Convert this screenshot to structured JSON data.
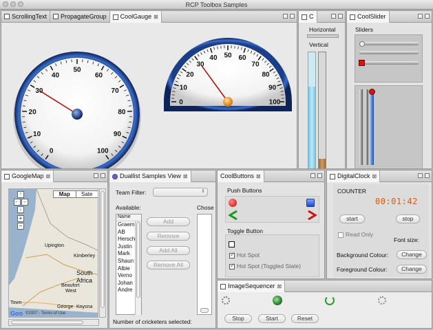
{
  "window": {
    "title": "RCP Toolbox Samples"
  },
  "gauge_pane": {
    "tabs": [
      "ScrollingText",
      "PropagateGroup",
      "CoolGauge"
    ],
    "full_gauge": {
      "ticks": [
        "0",
        "10",
        "20",
        "30",
        "40",
        "50",
        "60",
        "70",
        "80",
        "90",
        "100"
      ],
      "value": 30
    },
    "half_gauge": {
      "ticks": [
        "0",
        "10",
        "20",
        "30",
        "40",
        "50",
        "60",
        "70",
        "80",
        "90",
        "100"
      ],
      "value": 30
    }
  },
  "c_pane": {
    "tab": "C",
    "horizontal_label": "Horizontal",
    "vertical_label": "Vertical",
    "vertical_level": 0.1
  },
  "slider_pane": {
    "tab": "CoolSlider",
    "sliders_label": "Sliders"
  },
  "map_pane": {
    "tab": "GoogleMap",
    "map_type_options": [
      "Map",
      "Sate"
    ],
    "places": [
      "Upington",
      "Kimberley",
      "South",
      "Africa",
      "Beaufort",
      "West",
      "George",
      "Knysna",
      "Town"
    ],
    "copyright": "©2007 - Terms of Use"
  },
  "duallist_pane": {
    "tab": "Duallist Samples View",
    "team_filter_label": "Team Filter:",
    "available_label": "Available:",
    "chosen_label": "Chose",
    "column_header": "Name",
    "available_items": [
      "Graem",
      "AB",
      "Hersch",
      "Justin",
      "Mark",
      "Shaun",
      "Albie",
      "Verno",
      "Johan",
      "Andre"
    ],
    "buttons": [
      "Add",
      "Remove",
      "Add All",
      "Remove All"
    ],
    "count_label": "Number of cricketers selected:"
  },
  "coolbuttons_pane": {
    "tab": "CoolButtons",
    "push_label": "Push Buttons",
    "toggle_label": "Toggle Button",
    "hot_spot": "Hot Spot",
    "hot_spot_toggled": "Hot Spot (Toggled State)"
  },
  "digitalclock_pane": {
    "tab": "DigitalClock",
    "counter_label": "COUNTER",
    "time": "00:01:42",
    "start": "start",
    "stop": "stop",
    "read_only": "Read Only",
    "font_size": "Font size:",
    "background_colour": "Background Colour:",
    "foreground_colour": "Foreground Colour:",
    "change": "Change"
  },
  "imagesequencer_pane": {
    "tab": "ImageSequencer",
    "buttons": [
      "Stop",
      "Start",
      "Reset"
    ]
  }
}
